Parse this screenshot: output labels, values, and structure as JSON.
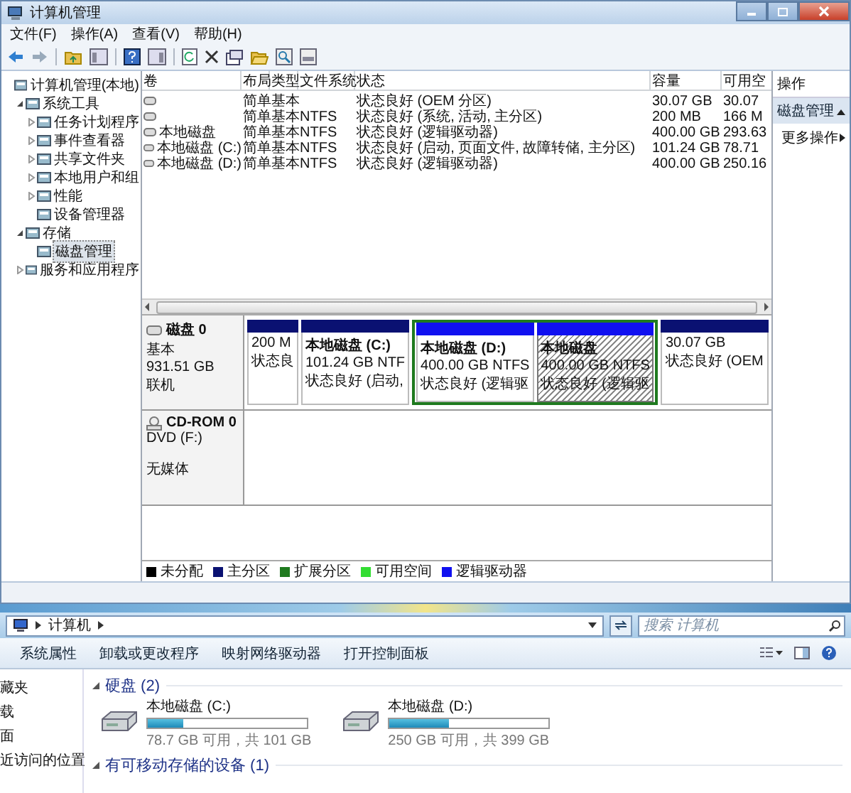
{
  "window": {
    "title": "计算机管理"
  },
  "menu": [
    "文件(F)",
    "操作(A)",
    "查看(V)",
    "帮助(H)"
  ],
  "tree": [
    {
      "label": "计算机管理(本地)",
      "selected": false,
      "children": [
        {
          "label": "系统工具",
          "expanded": true,
          "selected": false,
          "children": [
            {
              "label": "任务计划程序",
              "expanded": false,
              "selected": false
            },
            {
              "label": "事件查看器",
              "expanded": false,
              "selected": false
            },
            {
              "label": "共享文件夹",
              "expanded": false,
              "selected": false
            },
            {
              "label": "本地用户和组",
              "expanded": false,
              "selected": false
            },
            {
              "label": "性能",
              "expanded": false,
              "selected": false
            },
            {
              "label": "设备管理器",
              "selected": false
            }
          ]
        },
        {
          "label": "存储",
          "expanded": true,
          "selected": false,
          "children": [
            {
              "label": "磁盘管理",
              "selected": true
            }
          ]
        },
        {
          "label": "服务和应用程序",
          "expanded": false,
          "selected": false
        }
      ]
    }
  ],
  "table": {
    "columns": [
      "卷",
      "布局",
      "类型",
      "文件系统",
      "状态",
      "容量",
      "可用空"
    ],
    "rows": [
      {
        "layout": "简单",
        "type": "基本",
        "status": "状态良好 (OEM 分区)",
        "capacity": "30.07 GB",
        "free": "30.07"
      },
      {
        "layout": "简单",
        "type": "基本",
        "file_system": "NTFS",
        "status": "状态良好 (系统, 活动, 主分区)",
        "capacity": "200 MB",
        "free": "166 M"
      },
      {
        "volume": "本地磁盘",
        "layout": "简单",
        "type": "基本",
        "file_system": "NTFS",
        "status": "状态良好 (逻辑驱动器)",
        "capacity": "400.00 GB",
        "free": "293.63"
      },
      {
        "volume": "本地磁盘 (C:)",
        "layout": "简单",
        "type": "基本",
        "file_system": "NTFS",
        "status": "状态良好 (启动, 页面文件, 故障转储, 主分区)",
        "capacity": "101.24 GB",
        "free": "78.71"
      },
      {
        "volume": "本地磁盘 (D:)",
        "layout": "简单",
        "type": "基本",
        "file_system": "NTFS",
        "status": "状态良好 (逻辑驱动器)",
        "capacity": "400.00 GB",
        "free": "250.16"
      }
    ]
  },
  "actions": {
    "title": "操作",
    "items": [
      {
        "kind": "section",
        "label": "磁盘管理",
        "expanded": true
      },
      {
        "kind": "submenu",
        "label": "更多操作"
      }
    ]
  },
  "disks": [
    {
      "kind": "hdd",
      "name": "磁盘 0",
      "lines": [
        "基本",
        "931.51 GB",
        "联机"
      ],
      "partitions": [
        {
          "kind": "primary",
          "color": "#0a1172",
          "selected": false,
          "lines": [
            "200 M",
            "状态良"
          ]
        },
        {
          "kind": "primary",
          "color": "#0a1172",
          "selected": false,
          "title": "本地磁盘 (C:)",
          "lines": [
            "101.24 GB NTF",
            "状态良好 (启动,"
          ]
        },
        {
          "kind": "extended",
          "color": "#1f7a1f",
          "children": [
            {
              "kind": "logical",
              "color": "#1010f0",
              "selected": false,
              "title": "本地磁盘 (D:)",
              "lines": [
                "400.00 GB NTFS",
                "状态良好 (逻辑驱"
              ]
            },
            {
              "kind": "logical",
              "color": "#1010f0",
              "selected": true,
              "title": "本地磁盘",
              "lines": [
                "400.00 GB NTFS",
                "状态良好 (逻辑驱"
              ]
            }
          ]
        },
        {
          "kind": "primary",
          "color": "#0a1172",
          "selected": false,
          "lines": [
            "30.07 GB",
            "状态良好 (OEM"
          ]
        }
      ]
    },
    {
      "kind": "cdrom",
      "name": "CD-ROM 0",
      "lines": [
        "DVD (F:)",
        "无媒体"
      ]
    }
  ],
  "legend": [
    {
      "label": "未分配",
      "color": "#000000"
    },
    {
      "label": "主分区",
      "color": "#0a1172"
    },
    {
      "label": "扩展分区",
      "color": "#1f7a1f"
    },
    {
      "label": "可用空间",
      "color": "#33dd33"
    },
    {
      "label": "逻辑驱动器",
      "color": "#1010f0"
    }
  ],
  "explorer": {
    "breadcrumb": [
      "计算机"
    ],
    "search": {
      "placeholder": "搜索 计算机"
    },
    "toolbar": [
      "系统属性",
      "卸载或更改程序",
      "映射网络驱动器",
      "打开控制面板"
    ],
    "nav": [
      "藏夹",
      "载",
      "面",
      "近访问的位置"
    ],
    "groups": [
      {
        "title": "硬盘 (2)",
        "expanded": true,
        "drives": [
          {
            "name": "本地磁盘 (C:)",
            "level": 0.22,
            "caption": "78.7 GB 可用，共 101 GB"
          },
          {
            "name": "本地磁盘 (D:)",
            "level": 0.37,
            "caption": "250 GB 可用，共 399 GB"
          }
        ]
      },
      {
        "title": "有可移动存储的设备 (1)",
        "expanded": true
      }
    ]
  }
}
